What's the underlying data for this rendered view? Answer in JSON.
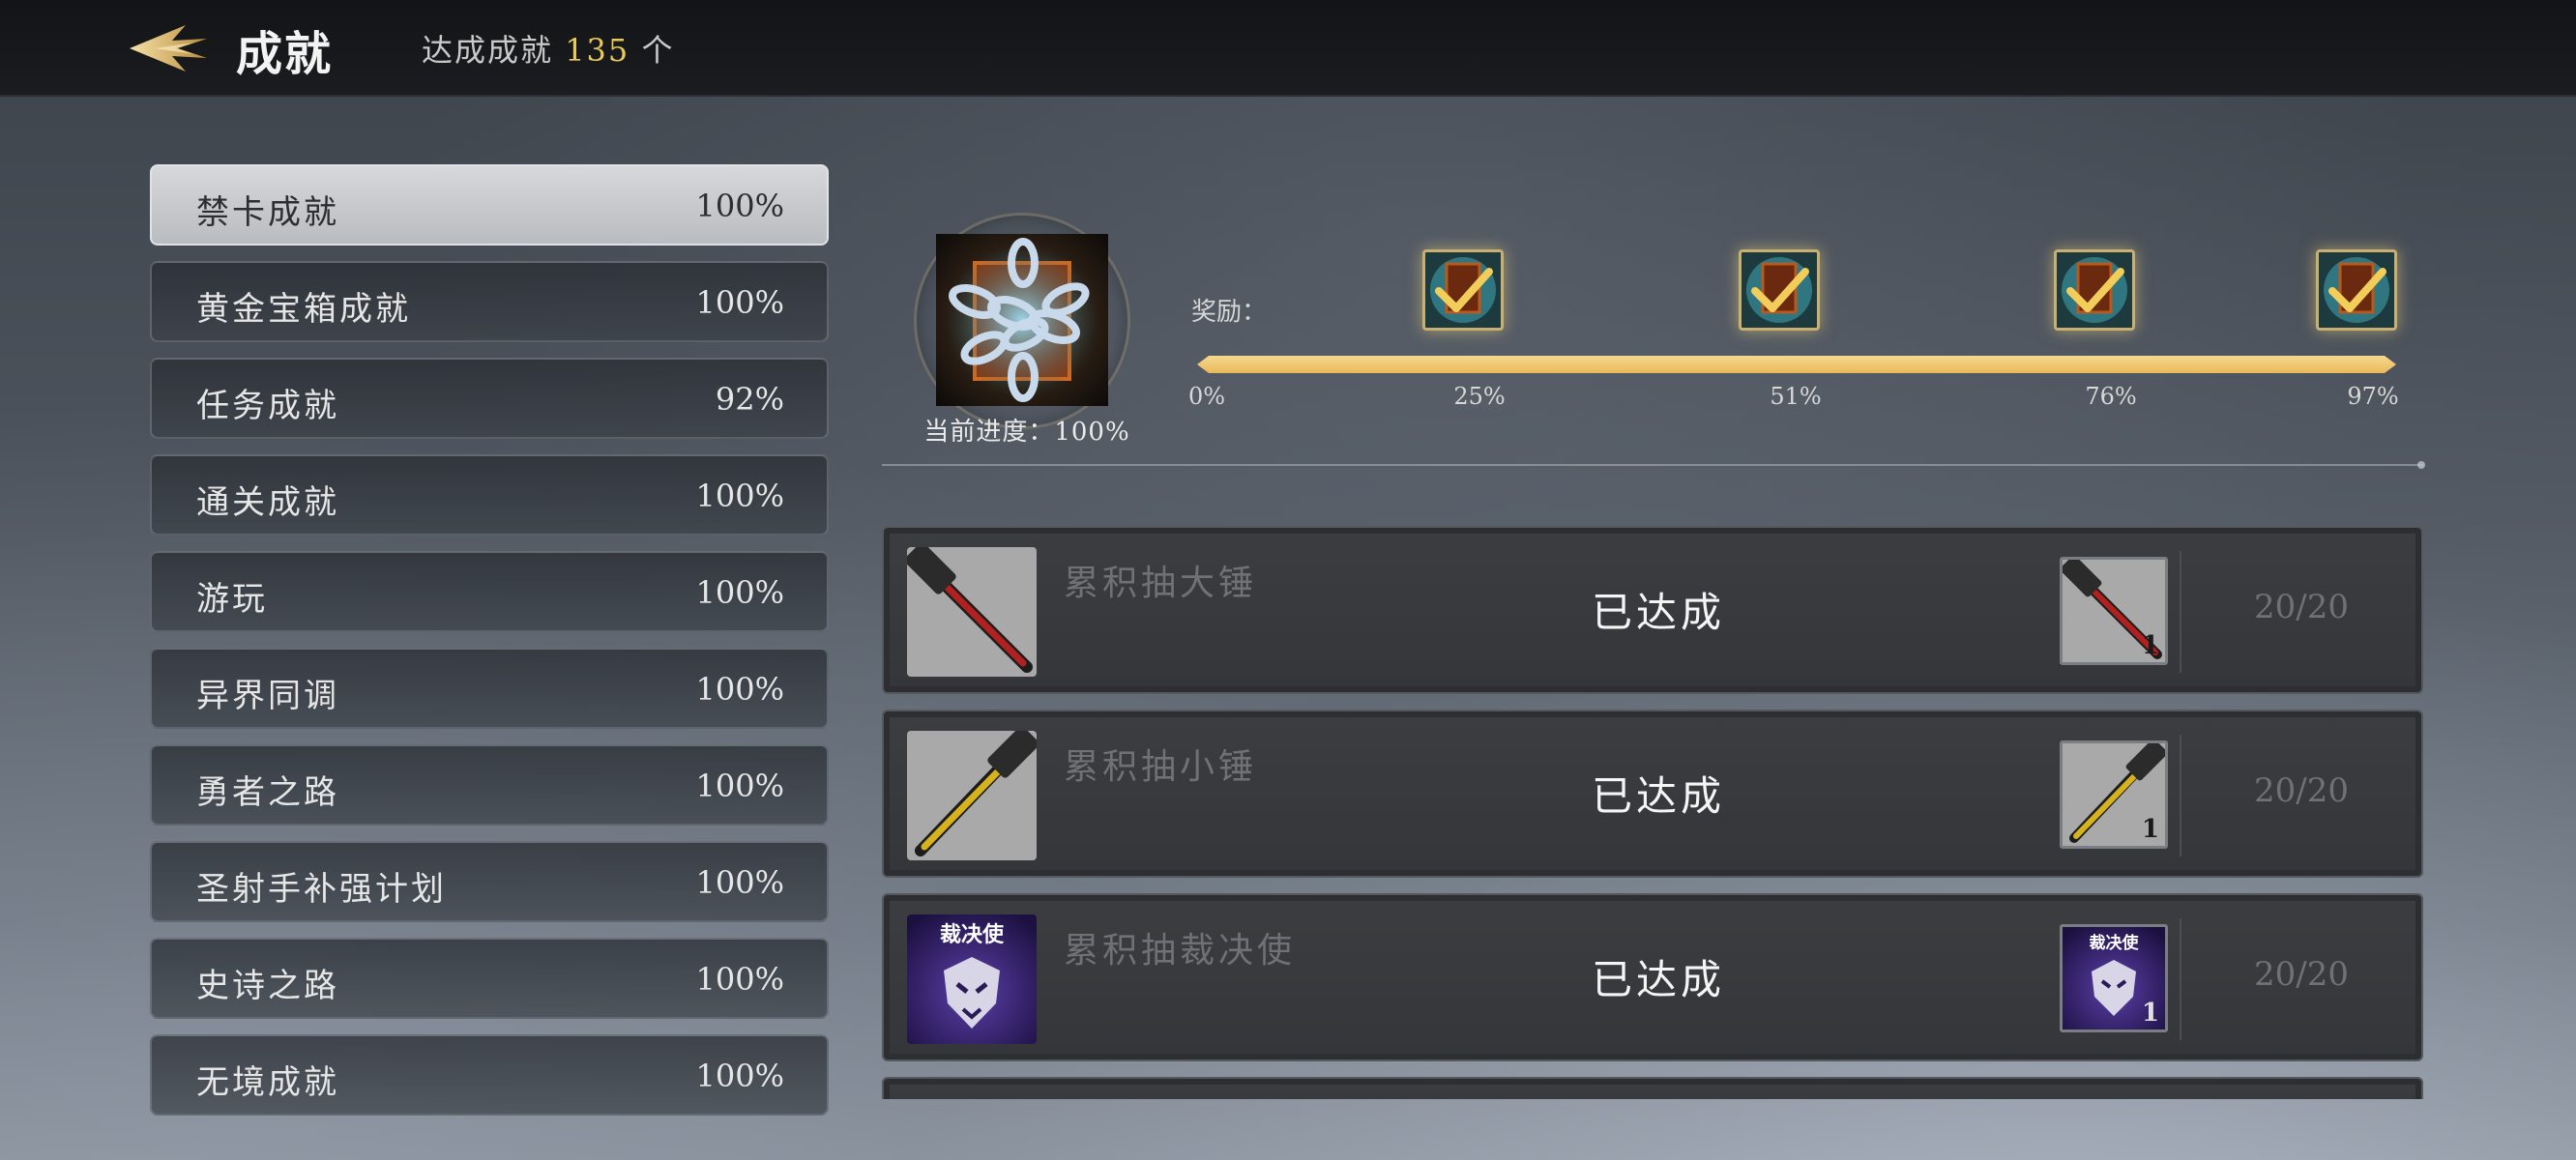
{
  "header": {
    "title": "成就",
    "count_prefix": "达成成就",
    "count_value": "135",
    "count_suffix": "个"
  },
  "categories": [
    {
      "name": "禁卡成就",
      "pct": "100%",
      "active": true
    },
    {
      "name": "黄金宝箱成就",
      "pct": "100%"
    },
    {
      "name": "任务成就",
      "pct": "92%"
    },
    {
      "name": "通关成就",
      "pct": "100%"
    },
    {
      "name": "游玩",
      "pct": "100%"
    },
    {
      "name": "异界同调",
      "pct": "100%"
    },
    {
      "name": "勇者之路",
      "pct": "100%"
    },
    {
      "name": "圣射手补强计划",
      "pct": "100%"
    },
    {
      "name": "史诗之路",
      "pct": "100%"
    },
    {
      "name": "无境成就",
      "pct": "100%"
    }
  ],
  "reward_panel": {
    "current_progress": "当前进度：100%",
    "reward_label": "奖励：",
    "progress_fraction": 1.0,
    "milestones": [
      "0%",
      "25%",
      "51%",
      "76%",
      "97%"
    ]
  },
  "tasks": [
    {
      "name": "累积抽大锤",
      "status": "已达成",
      "reward_qty": "1",
      "progress": "20/20",
      "icon": "sledgehammer-red-icon"
    },
    {
      "name": "累积抽小锤",
      "status": "已达成",
      "reward_qty": "1",
      "progress": "20/20",
      "icon": "sledgehammer-yellow-icon"
    },
    {
      "name": "累积抽裁决使",
      "status": "已达成",
      "reward_qty": "1",
      "progress": "20/20",
      "icon": "judge-card-icon",
      "icon_label": "裁决使"
    }
  ],
  "colors": {
    "accent_gold": "#e8c95a",
    "track_gold": "#efc66e",
    "active_tab": "#c8cacd"
  }
}
